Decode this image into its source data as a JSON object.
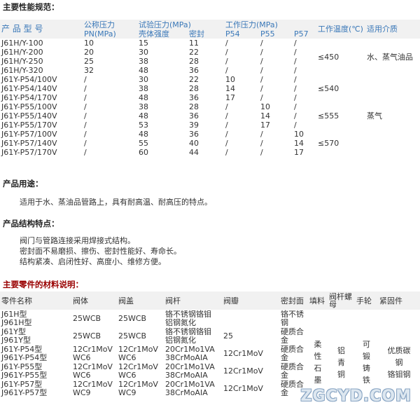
{
  "spec_section": {
    "title": "主要性能规范：",
    "headers": {
      "model": "产 品 型 号",
      "nominal_line1": "公称压力",
      "nominal_line2": "PN(MPa)",
      "test_line1": "试验压力(MPa)",
      "test_shell": "壳体强度",
      "test_seal": "密封",
      "work_line1": "工作压力(MPa)",
      "p54": "P54",
      "p55": "P55",
      "p57": "P57",
      "temp": "工作温度(℃)",
      "medium": "适用介质"
    },
    "rows": [
      [
        "J61H/Y-100",
        "10",
        "15",
        "11",
        "/",
        "/",
        "/"
      ],
      [
        "J61H/Y-200",
        "20",
        "30",
        "22",
        "/",
        "/",
        "/"
      ],
      [
        "J61H/Y-250",
        "25",
        "38",
        "28",
        "/",
        "/",
        "/"
      ],
      [
        "J61H/Y-320",
        "32",
        "48",
        "36",
        "/",
        "/",
        "/"
      ],
      [
        "J61Y-P54/100V",
        "/",
        "30",
        "22",
        "10",
        "/",
        "/"
      ],
      [
        "J61Y-P54/140V",
        "/",
        "38",
        "28",
        "14",
        "/",
        "/"
      ],
      [
        "J61Y-P54/170V",
        "/",
        "48",
        "36",
        "17",
        "/",
        "/"
      ],
      [
        "J61Y-P55/100V",
        "/",
        "38",
        "28",
        "/",
        "10",
        "/"
      ],
      [
        "J61Y-P55/140V",
        "/",
        "48",
        "36",
        "/",
        "14",
        "/"
      ],
      [
        "J61Y-P55/170V",
        "/",
        "53",
        "39",
        "/",
        "17",
        "/"
      ],
      [
        "J61Y-P57/100V",
        "/",
        "48",
        "36",
        "/",
        "/",
        "10"
      ],
      [
        "J61Y-P57/140V",
        "/",
        "55",
        "40",
        "/",
        "/",
        "14"
      ],
      [
        "J61Y-P57/170V",
        "/",
        "60",
        "44",
        "/",
        "/",
        "17"
      ]
    ],
    "temps": [
      "≤450",
      "≤540",
      "≤555",
      "≤570"
    ],
    "media": [
      "水、蒸气油品",
      "蒸气"
    ]
  },
  "usage_section": {
    "title": "产品用途：",
    "text": "适用于水、蒸油品管路上，具有耐高温、耐高压的特点。"
  },
  "structure_section": {
    "title": "产品结构特点：",
    "lines": [
      "阀门与管路连接采用焊接式结构。",
      "密封面不易磨损、擦伤、密封性能好、寿命长。",
      "结构紧凑、启闭性好、高度小、维修方便。"
    ]
  },
  "parts_section": {
    "title": "主要零件的材料说明：",
    "headers": [
      "零件名称",
      "阀体",
      "阀盖",
      "阀杆",
      "阀瓣",
      "密封面",
      "填料",
      "阀杆螺母",
      "手轮",
      "紧固件"
    ],
    "rows": [
      {
        "name": "J61H型\nJ961H型",
        "body": "25WCB",
        "bonnet": "25WCB",
        "stem": "铬不锈钢铬钼\n铝钢氮化",
        "disc": "",
        "seal": "铬不锈\n钢"
      },
      {
        "name": "J61Y型\nJ961Y型",
        "body": "25WCB",
        "bonnet": "25WCB",
        "stem": "铬不锈钢铬钼\n铝钢氮化",
        "disc": "25",
        "seal": "硬质合\n金"
      },
      {
        "name": "J61Y-P54型\nJ961Y-P54型",
        "body": "12Cr1MoV\nWC6",
        "bonnet": "12Cr1MoV\nWC6",
        "stem": "20Cr1Mo1VA\n38CrMoAIA",
        "disc": "12Cr1MoV",
        "seal": "硬质合\n金"
      },
      {
        "name": "J61Y-P55型\nJ961Y-P55型",
        "body": "12Cr1MoV\nWC6",
        "bonnet": "12Cr1MoV\nWC6",
        "stem": "20Cr1Mo1VA\n38CrMoAIA",
        "disc": "12Cr1MoV",
        "seal": "硬质合\n金"
      },
      {
        "name": "J61Y-P57型\nJ961Y-P57型",
        "body": "12Cr1MoV\nWC9",
        "bonnet": "12Cr1MoV\nWC9",
        "stem": "20Cr1Mo1VA\n38CrMoAIA",
        "disc": "12Cr1MoV",
        "seal": "硬质合\n金"
      }
    ],
    "packing": "柔\n性\n石\n墨",
    "stem_nut": "铝\n青\n铜",
    "handwheel": "可\n锻\n铸\n铁",
    "fastener": "优质碳\n钢\n铬钼钢"
  },
  "watermark": "ZGCYD.COM"
}
